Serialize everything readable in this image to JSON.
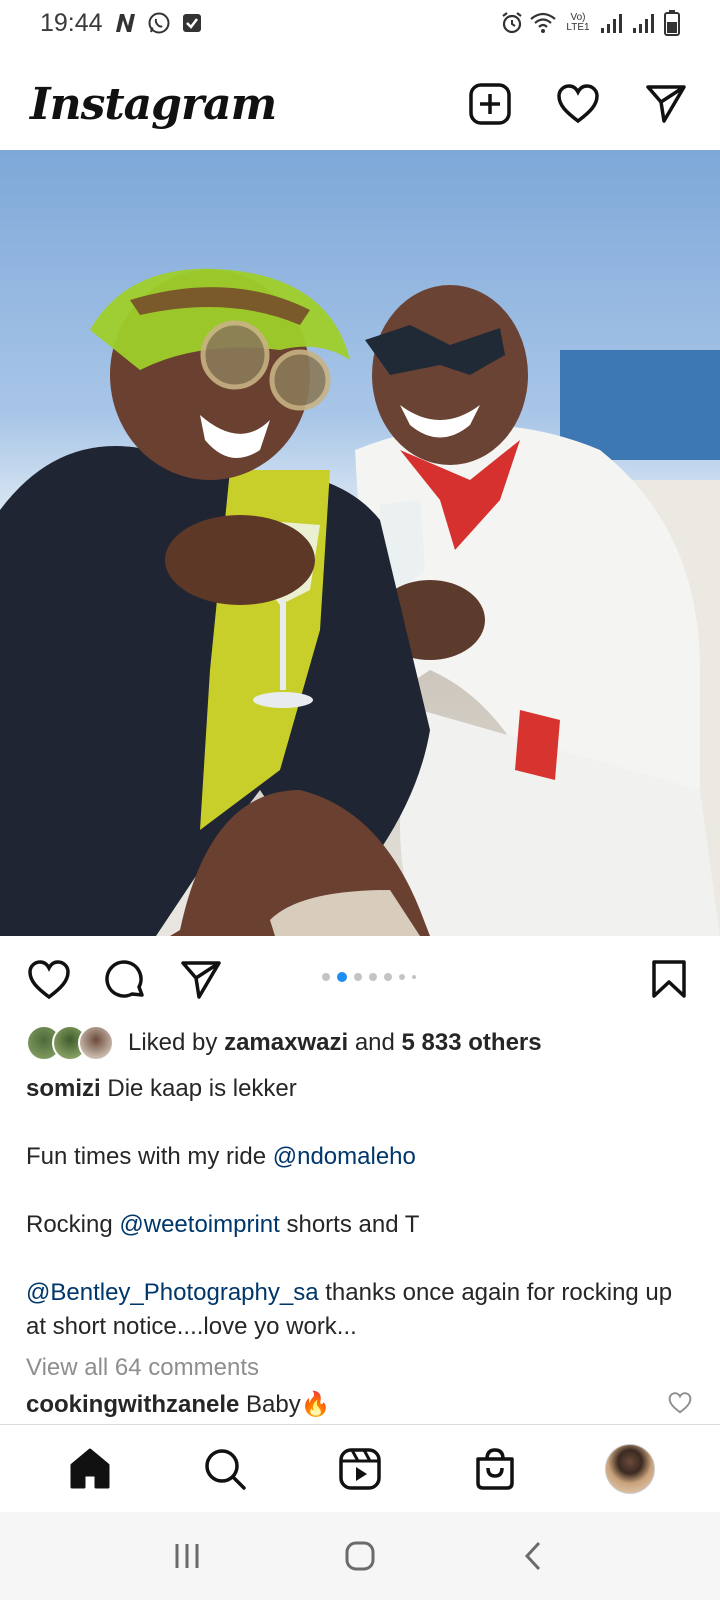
{
  "status_bar": {
    "time": "19:44",
    "network_label": "Vo) LTE1"
  },
  "header": {
    "logo": "Instagram"
  },
  "post": {
    "carousel": {
      "count": 7,
      "active_index": 1
    },
    "likes": {
      "prefix": "Liked by",
      "user": "zamaxwazi",
      "connector": "and",
      "others": "5 833 others"
    },
    "caption": {
      "username": "somizi",
      "line1": "Die kaap is lekker",
      "line2_text": "Fun times with my ride",
      "line2_mention": "@ndomaleho",
      "line3_text1": "Rocking",
      "line3_mention": "@weetoimprint",
      "line3_text2": "shorts and T",
      "line4_mention": "@Bentley_Photography_sa",
      "line4_text": "thanks once again for rocking up at short notice....love yo work..."
    },
    "view_comments": "View all 64 comments",
    "comment": {
      "username": "cookingwithzanele",
      "text": "Baby",
      "emoji": "🔥"
    }
  },
  "colors": {
    "accent_blue": "#1f8ef1",
    "mention": "#00376b",
    "muted": "#8e8e8e"
  }
}
